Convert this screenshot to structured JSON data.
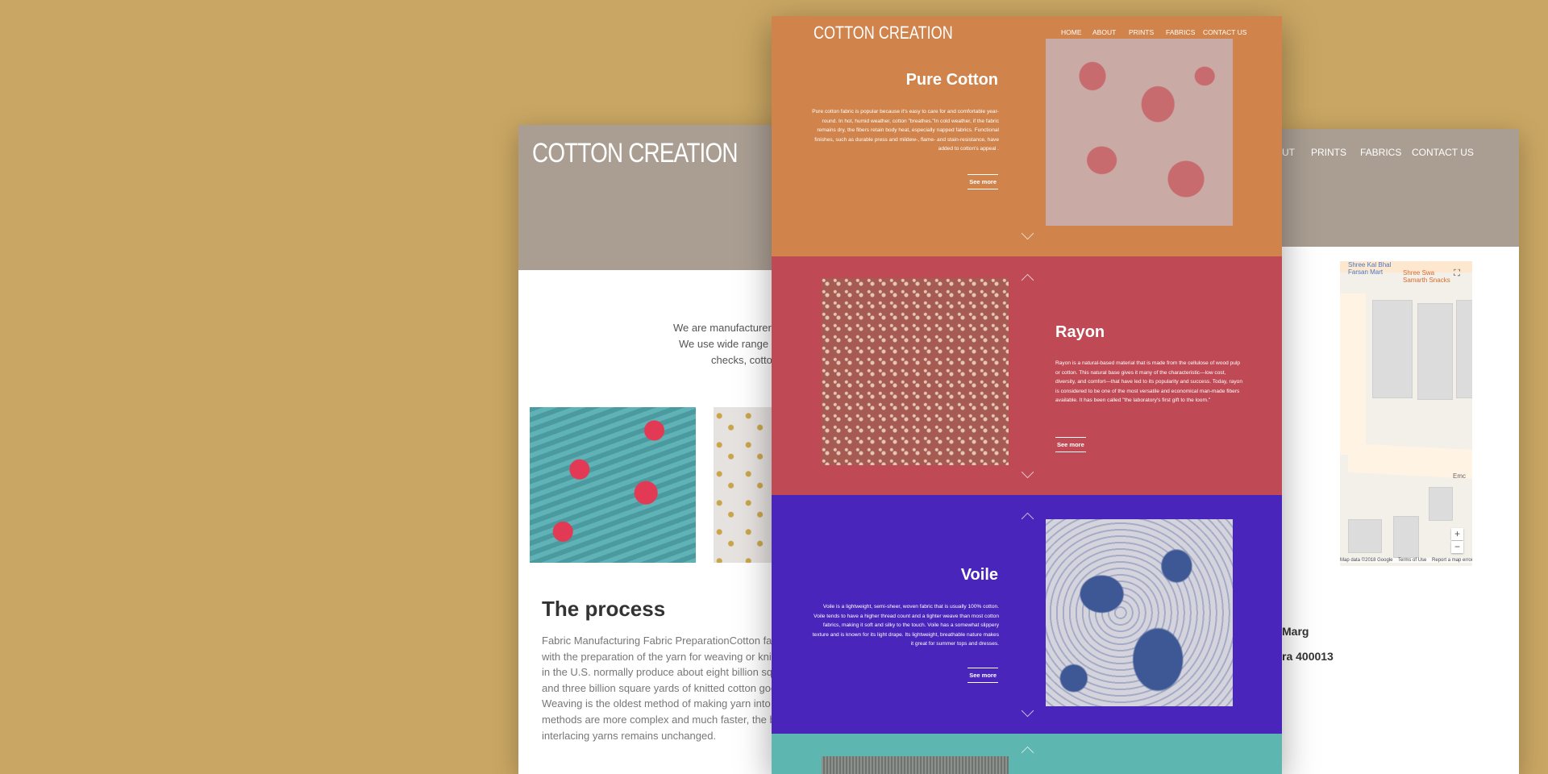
{
  "colors": {
    "background": "#c9a663",
    "back_header": "#aa9e93",
    "pure_cotton": "#d0834a",
    "rayon": "#bf4a55",
    "voile": "#4925bb",
    "teal": "#5eb6b1"
  },
  "back_left": {
    "logo": "COTTON CREATION",
    "intro_lines": [
      "We are manufacturer, w",
      "We use wide range of",
      "checks, cotton"
    ],
    "process_title": "The process",
    "process_lines": [
      "Fabric Manufacturing Fabric PreparationCotton fabric m",
      "with the preparation of the yarn for weaving or knitting.",
      "in the U.S. normally produce about eight billion square y",
      "and three billion square yards of knitted cotton goods. W",
      "Weaving is the oldest method of making yarn into fabric",
      "methods are more complex and much faster, the basic p",
      "interlacing yarns remains unchanged."
    ]
  },
  "back_right": {
    "nav": [
      "UT",
      "PRINTS",
      "FABRICS",
      "CONTACT US"
    ],
    "map": {
      "label1": "Shree Kal Bhal\nFarsan Mart",
      "label2": "Shree Swa\nSamarth Snacks",
      "label3": "Emc",
      "footer": "Map data ©2018 Google    Terms of Use    Report a map error",
      "zoom_in": "+",
      "zoom_out": "−",
      "fullscreen": "⛶"
    },
    "address_lines": [
      "Marg",
      "ra 400013"
    ]
  },
  "front": {
    "logo": "COTTON CREATION",
    "nav": [
      "HOME",
      "ABOUT",
      "PRINTS",
      "FABRICS",
      "CONTACT US"
    ],
    "sections": [
      {
        "title": "Pure Cotton",
        "text": "Pure cotton fabric is popular because it's easy to care for and comfortable year-round. In hot, humid weather, cotton \"breathes.\"In cold weather, if the fabric remains dry, the fibers retain body heat, especially napped fabrics. Functional finishes, such as durable press and mildew-, flame- and stain-resistance, have added to cotton's appeal .",
        "button": "See more"
      },
      {
        "title": "Rayon",
        "text": "Rayon is a natural-based material that is made from the cellulose of wood pulp or cotton. This natural base gives it many of the characteristic—low cost, diversity, and comfort—that have led to its popularity and success. Today, rayon is considered to be one of the most versatile and economical man-made fibers available. It has been called \"the laboratory's first gift to the loom.\"",
        "button": "See more"
      },
      {
        "title": "Voile",
        "text": "Voile is a lightweight, semi-sheer, woven fabric that is usually 100% cotton. Voile tends to have a higher thread count and a tighter weave than most cotton fabrics, making it soft and silky to the touch. Voile has a somewhat slippery texture and is known for its light drape. Its lightweight, breathable nature makes it great for summer tops and dresses.",
        "button": "See more"
      }
    ]
  }
}
